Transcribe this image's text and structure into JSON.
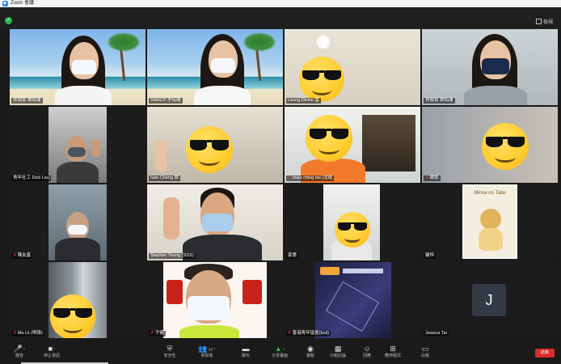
{
  "window": {
    "title": "Zoom 會議",
    "app_icon": "zoom-icon"
  },
  "top": {
    "view_label": "檢視"
  },
  "participants": [
    {
      "name": "青頭會 謝佑珊",
      "muted": false
    },
    {
      "name": "SMACP 李佑珊",
      "muted": false
    },
    {
      "name": "Leung Dickie 雲",
      "muted": false
    },
    {
      "name": "青頭會 劉佑珊",
      "muted": false
    },
    {
      "name": "青年社工 Dick Lau",
      "muted": false
    },
    {
      "name": "Ivan Cheng 鄭",
      "muted": false
    },
    {
      "name": "chan ching hsi (沈瑤",
      "muted": true
    },
    {
      "name": "蘇凱",
      "muted": true
    },
    {
      "name": "陳友鑫",
      "muted": true
    },
    {
      "name": "Stephen Yeung (SDS)",
      "muted": false
    },
    {
      "name": "家惠",
      "muted": false
    },
    {
      "name": "健恒",
      "muted": false
    },
    {
      "name": "Ma Lk (明偉)",
      "muted": true
    },
    {
      "name": "子健",
      "muted": true
    },
    {
      "name": "香港青年協會(bcd)",
      "muted": true
    },
    {
      "name": "Jessica Tai",
      "muted": false
    }
  ],
  "avatar_letter": "J",
  "card_title": "Minna no Tabe",
  "toolbar": {
    "mute": "靜音",
    "video": "停止視訊",
    "security": "安全性",
    "participants": "參與者",
    "participants_count": "16",
    "chat": "聊天",
    "share": "分享畫面",
    "record": "錄製",
    "breakout": "分組討論",
    "reactions": "回應",
    "apps": "應用程式",
    "whiteboard": "白板",
    "end": "結束"
  },
  "colors": {
    "active_speaker": "#e6e25a",
    "end_button": "#d92d2d",
    "share_icon": "#2db84d",
    "muted_icon": "#ff3b30"
  }
}
